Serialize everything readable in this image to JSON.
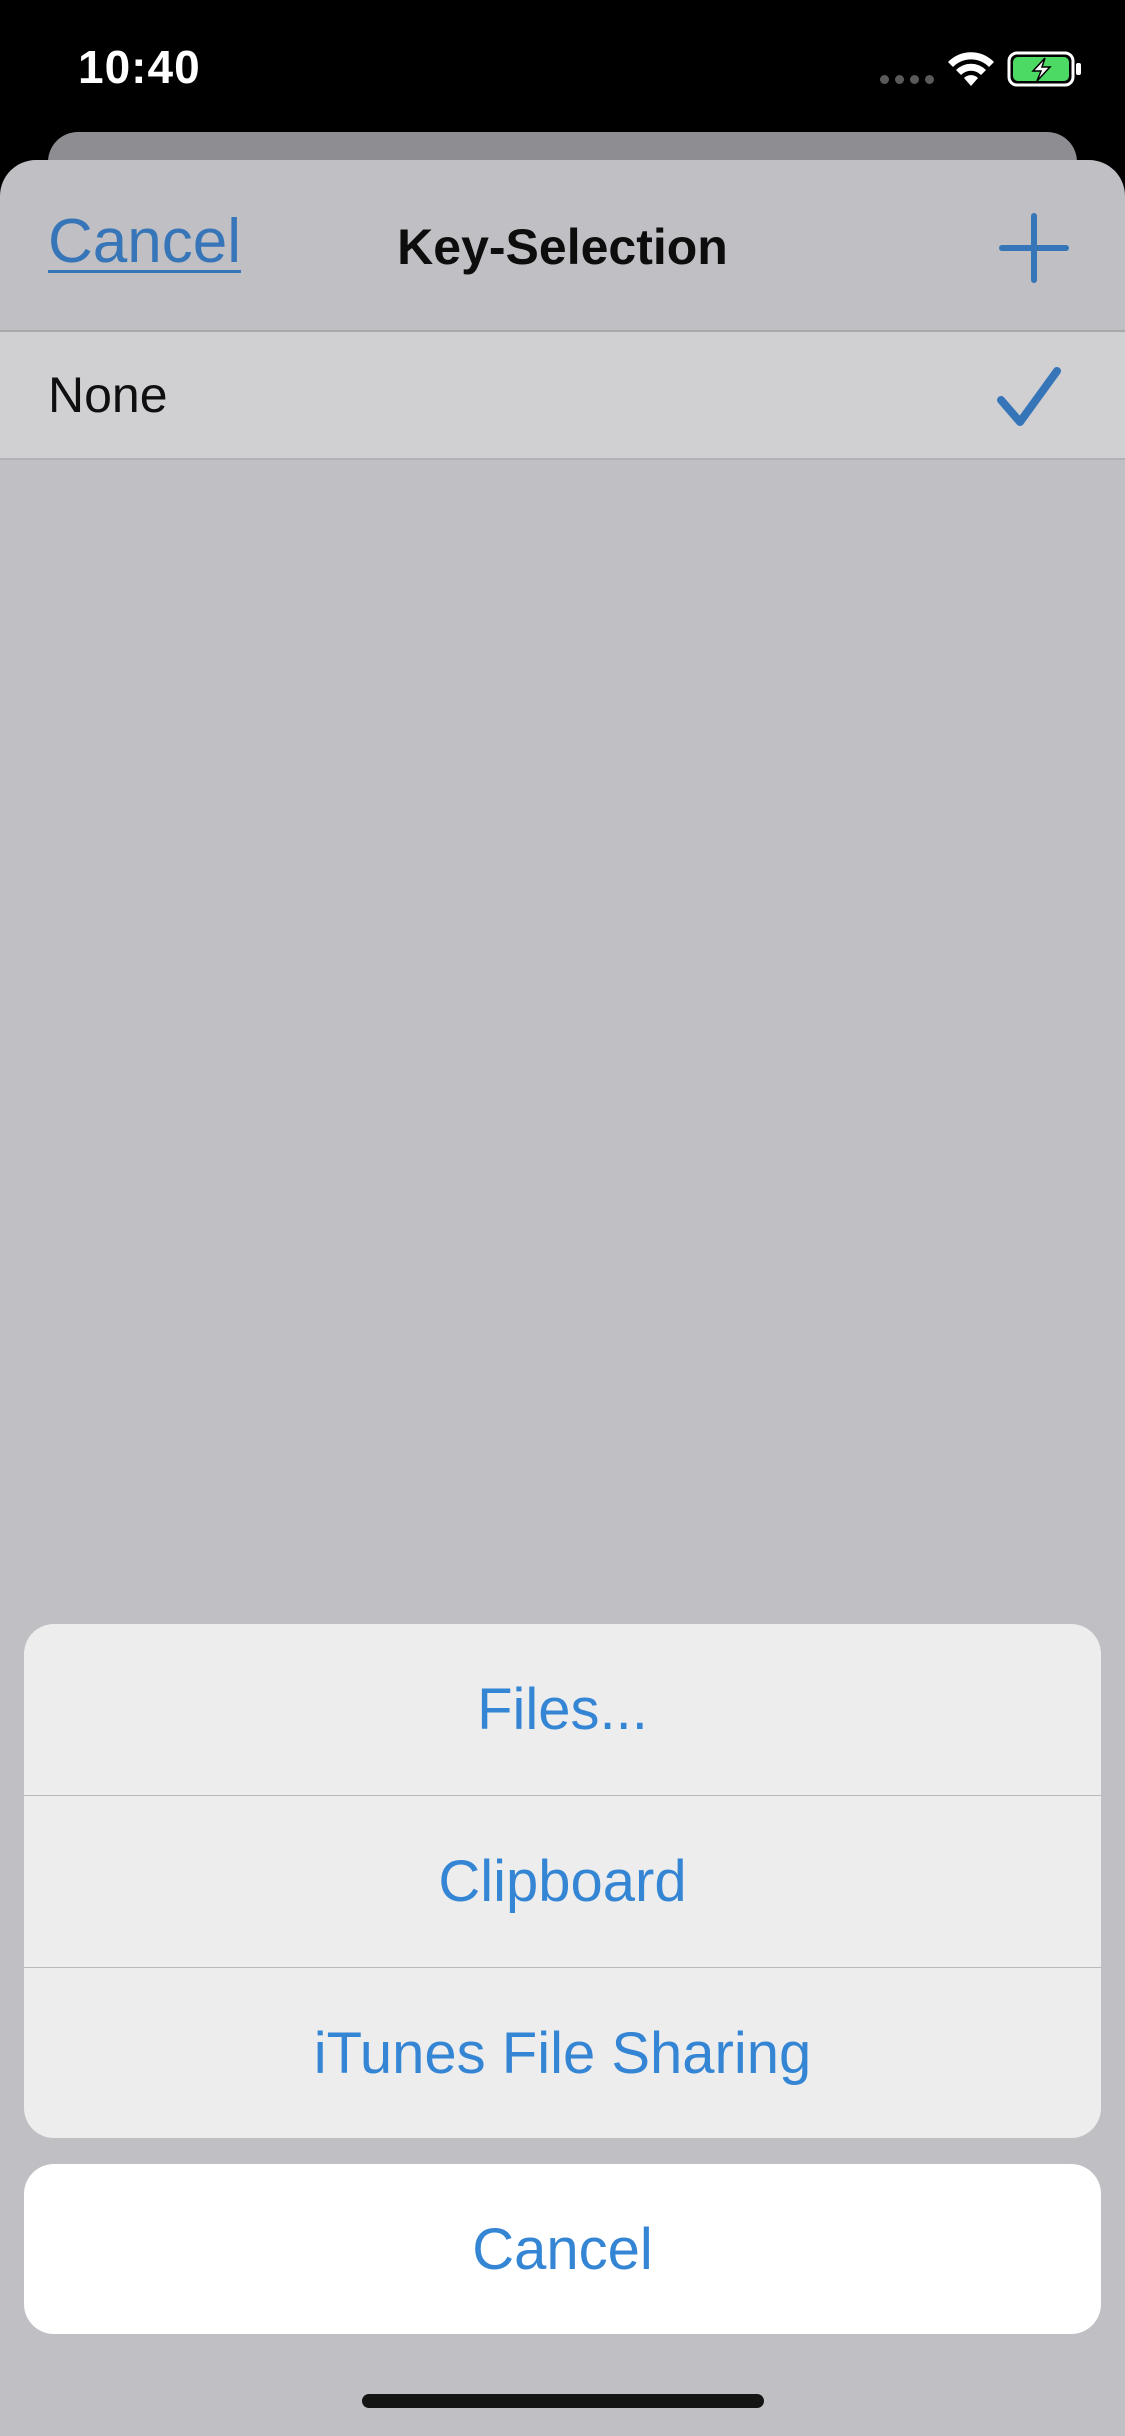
{
  "status_bar": {
    "time": "10:40",
    "signal_icon": "cellular-signal-icon",
    "wifi_icon": "wifi-icon",
    "battery_icon": "battery-charging-icon"
  },
  "nav": {
    "cancel_label": "Cancel",
    "title": "Key-Selection",
    "add_icon": "plus-icon"
  },
  "list": {
    "items": [
      {
        "label": "None",
        "selected": true,
        "accessory_icon": "checkmark-icon"
      }
    ]
  },
  "action_sheet": {
    "options": [
      {
        "label": "Files..."
      },
      {
        "label": "Clipboard"
      },
      {
        "label": "iTunes File Sharing"
      }
    ],
    "cancel_label": "Cancel"
  },
  "colors": {
    "accent": "#3485d4",
    "nav_accent": "#3575b8",
    "battery_green": "#4cd964",
    "dimmed_background": "#c0bfc4"
  }
}
